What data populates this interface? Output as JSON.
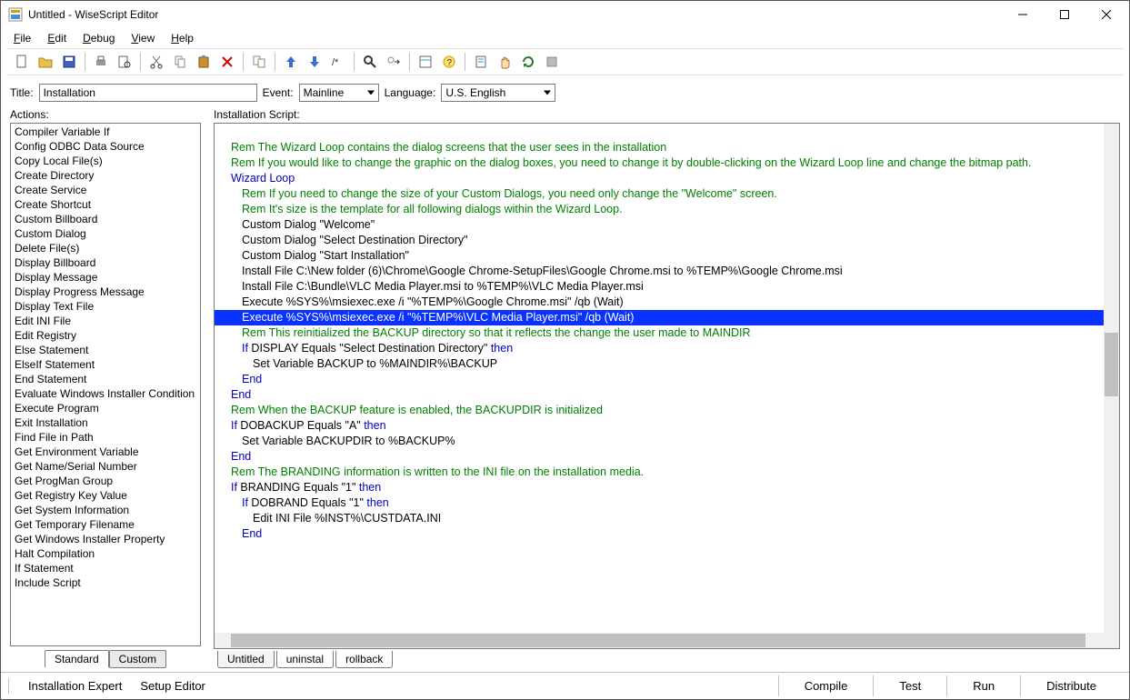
{
  "window": {
    "title": "Untitled - WiseScript Editor"
  },
  "menu": [
    "File",
    "Edit",
    "Debug",
    "View",
    "Help"
  ],
  "toolbar_icons": [
    "new-icon",
    "open-icon",
    "save-icon",
    "sep",
    "print-icon",
    "print-preview-icon",
    "sep",
    "cut-icon",
    "copy-icon",
    "paste-icon",
    "delete-icon",
    "sep",
    "duplicate-icon",
    "sep",
    "move-up-icon",
    "move-down-icon",
    "comment-icon",
    "sep",
    "find-icon",
    "find-next-icon",
    "sep",
    "properties-icon",
    "help-icon",
    "sep",
    "event-icon",
    "hand-icon",
    "refresh-icon",
    "stop-icon"
  ],
  "fieldbar": {
    "title_label": "Title:",
    "title_value": "Installation",
    "event_label": "Event:",
    "event_value": "Mainline",
    "language_label": "Language:",
    "language_value": "U.S. English"
  },
  "left": {
    "label": "Actions:",
    "items": [
      "Compiler Variable If",
      "Config ODBC Data Source",
      "Copy Local File(s)",
      "Create Directory",
      "Create Service",
      "Create Shortcut",
      "Custom Billboard",
      "Custom Dialog",
      "Delete File(s)",
      "Display Billboard",
      "Display Message",
      "Display Progress Message",
      "Display Text File",
      "Edit INI File",
      "Edit Registry",
      "Else Statement",
      "ElseIf Statement",
      "End Statement",
      "Evaluate Windows Installer Condition",
      "Execute Program",
      "Exit Installation",
      "Find File in Path",
      "Get Environment Variable",
      "Get Name/Serial Number",
      "Get ProgMan Group",
      "Get Registry Key Value",
      "Get System Information",
      "Get Temporary Filename",
      "Get Windows Installer Property",
      "Halt Compilation",
      "If Statement",
      "Include Script"
    ],
    "buttons": {
      "standard": "Standard",
      "custom": "Custom"
    }
  },
  "right": {
    "label": "Installation Script:",
    "lines": [
      {
        "indent": 1,
        "cls": "c-rem",
        "text": "Rem The Wizard Loop contains the dialog screens that the user sees in the installation"
      },
      {
        "indent": 1,
        "cls": "c-rem",
        "text": "Rem If you would like to change the graphic on the dialog boxes, you need to change it by double-clicking on the Wizard Loop line and change the bitmap path."
      },
      {
        "indent": 1,
        "cls": "c-key",
        "text": "Wizard Loop"
      },
      {
        "indent": 2,
        "cls": "c-rem",
        "text": "Rem If you need to change the size of your Custom Dialogs, you need only change the \"Welcome\" screen."
      },
      {
        "indent": 2,
        "cls": "c-rem",
        "text": "Rem It's size is the template for all following dialogs within the Wizard Loop."
      },
      {
        "indent": 2,
        "cls": "c-plain",
        "text": "Custom Dialog \"Welcome\""
      },
      {
        "indent": 2,
        "cls": "c-plain",
        "text": "Custom Dialog \"Select Destination Directory\""
      },
      {
        "indent": 2,
        "cls": "c-plain",
        "text": "Custom Dialog \"Start Installation\""
      },
      {
        "indent": 2,
        "cls": "c-plain",
        "text": "Install File C:\\New folder (6)\\Chrome\\Google Chrome-SetupFiles\\Google Chrome.msi to %TEMP%\\Google Chrome.msi"
      },
      {
        "indent": 2,
        "cls": "c-plain",
        "text": "Install File C:\\Bundle\\VLC Media Player.msi to %TEMP%\\VLC Media Player.msi"
      },
      {
        "indent": 2,
        "cls": "c-plain",
        "text": "Execute %SYS%\\msiexec.exe /i \"%TEMP%\\Google Chrome.msi\" /qb (Wait)"
      },
      {
        "indent": 2,
        "cls": "c-plain",
        "selected": true,
        "text": "Execute %SYS%\\msiexec.exe /i \"%TEMP%\\VLC Media Player.msi\" /qb (Wait)"
      },
      {
        "indent": 2,
        "cls": "c-rem",
        "text": "Rem This reinitialized the BACKUP directory so that it reflects the change the user made to MAINDIR"
      },
      {
        "indent": 2,
        "cls": "mixed",
        "parts": [
          {
            "c": "c-key",
            "t": "If "
          },
          {
            "c": "c-plain",
            "t": "DISPLAY Equals \"Select Destination Directory\" "
          },
          {
            "c": "c-key",
            "t": "then"
          }
        ]
      },
      {
        "indent": 3,
        "cls": "c-plain",
        "text": "Set Variable BACKUP to %MAINDIR%\\BACKUP"
      },
      {
        "indent": 2,
        "cls": "c-key",
        "text": "End"
      },
      {
        "indent": 1,
        "cls": "c-key",
        "text": "End"
      },
      {
        "indent": 1,
        "cls": "c-plain",
        "text": " "
      },
      {
        "indent": 1,
        "cls": "c-rem",
        "text": "Rem When the BACKUP feature is enabled, the BACKUPDIR is initialized"
      },
      {
        "indent": 1,
        "cls": "mixed",
        "parts": [
          {
            "c": "c-key",
            "t": "If "
          },
          {
            "c": "c-plain",
            "t": "DOBACKUP Equals \"A\" "
          },
          {
            "c": "c-key",
            "t": "then"
          }
        ]
      },
      {
        "indent": 2,
        "cls": "c-plain",
        "text": "Set Variable BACKUPDIR to %BACKUP%"
      },
      {
        "indent": 1,
        "cls": "c-key",
        "text": "End"
      },
      {
        "indent": 1,
        "cls": "c-plain",
        "text": " "
      },
      {
        "indent": 1,
        "cls": "c-rem",
        "text": "Rem The BRANDING information is written to the INI file on the installation media."
      },
      {
        "indent": 1,
        "cls": "mixed",
        "parts": [
          {
            "c": "c-key",
            "t": "If "
          },
          {
            "c": "c-plain",
            "t": "BRANDING Equals \"1\" "
          },
          {
            "c": "c-key",
            "t": "then"
          }
        ]
      },
      {
        "indent": 2,
        "cls": "mixed",
        "parts": [
          {
            "c": "c-key",
            "t": "If "
          },
          {
            "c": "c-plain",
            "t": "DOBRAND Equals \"1\" "
          },
          {
            "c": "c-key",
            "t": "then"
          }
        ]
      },
      {
        "indent": 3,
        "cls": "c-plain",
        "text": "Edit INI File %INST%\\CUSTDATA.INI"
      },
      {
        "indent": 2,
        "cls": "c-key",
        "text": "End"
      }
    ],
    "tabs": [
      "Untitled",
      "uninstal",
      "rollback"
    ]
  },
  "bottom": {
    "left_tabs": [
      "Installation Expert",
      "Setup Editor"
    ],
    "right_actions": [
      "Compile",
      "Test",
      "Run",
      "Distribute"
    ]
  }
}
